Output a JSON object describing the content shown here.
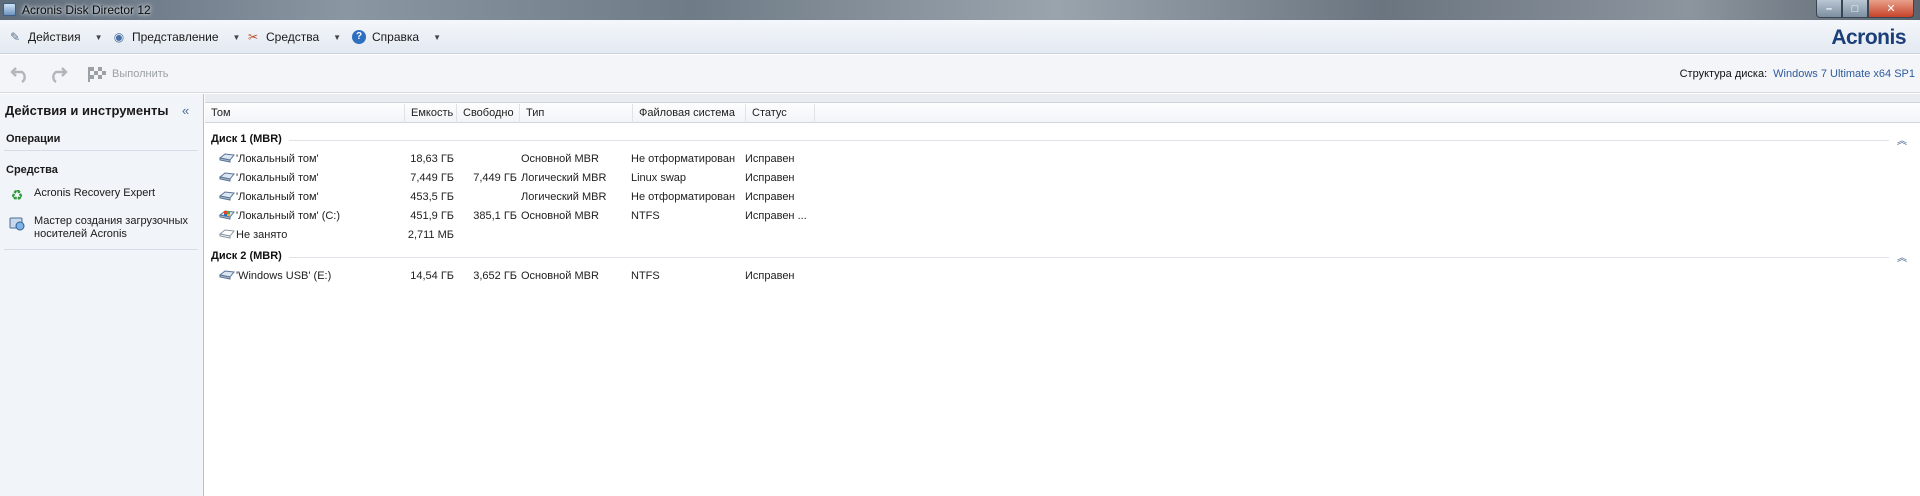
{
  "window": {
    "title": "Acronis Disk Director 12",
    "controls": {
      "minimize": "–",
      "maximize": "□",
      "close": "✕"
    }
  },
  "menu": {
    "items": [
      {
        "label": "Действия",
        "icon": "wrench-icon"
      },
      {
        "label": "Представление",
        "icon": "eye-icon"
      },
      {
        "label": "Средства",
        "icon": "tools-icon"
      },
      {
        "label": "Справка",
        "icon": "help-icon"
      }
    ],
    "logo": "Acronis"
  },
  "toolbar": {
    "undo_icon": "undo-icon",
    "redo_icon": "redo-icon",
    "run_label": "Выполнить",
    "disk_structure_label": "Структура диска:",
    "disk_structure_value": "Windows 7 Ultimate x64 SP1"
  },
  "sidebar": {
    "header": "Действия и инструменты",
    "collapse_glyph": "«",
    "sections": {
      "operations": "Операции",
      "tools": "Средства"
    },
    "tools": [
      {
        "label": "Acronis Recovery Expert",
        "icon": "recycle-icon"
      },
      {
        "label": "Мастер создания загрузочных носителей Acronis",
        "icon": "bootable-media-icon"
      }
    ]
  },
  "table": {
    "columns": [
      "Том",
      "Емкость",
      "Свободно",
      "Тип",
      "Файловая система",
      "Статус"
    ],
    "groups": [
      {
        "title": "Диск 1 (MBR)",
        "rows": [
          {
            "volume": "'Локальный том'",
            "capacity": "18,63 ГБ",
            "free": "",
            "type": "Основной MBR",
            "fs": "Не отформатирован",
            "status": "Исправен",
            "icon": "volume-icon"
          },
          {
            "volume": "'Локальный том'",
            "capacity": "7,449 ГБ",
            "free": "7,449 ГБ",
            "type": "Логический MBR",
            "fs": "Linux swap",
            "status": "Исправен",
            "icon": "volume-icon"
          },
          {
            "volume": "'Локальный том'",
            "capacity": "453,5 ГБ",
            "free": "",
            "type": "Логический MBR",
            "fs": "Не отформатирован",
            "status": "Исправен",
            "icon": "volume-icon"
          },
          {
            "volume": "'Локальный том' (C:)",
            "capacity": "451,9 ГБ",
            "free": "385,1 ГБ",
            "type": "Основной MBR",
            "fs": "NTFS",
            "status": "Исправен ...",
            "icon": "system-volume-icon"
          },
          {
            "volume": "Не занято",
            "capacity": "2,711 МБ",
            "free": "",
            "type": "",
            "fs": "",
            "status": "",
            "icon": "unallocated-icon"
          }
        ]
      },
      {
        "title": "Диск 2 (MBR)",
        "rows": [
          {
            "volume": "'Windows USB' (E:)",
            "capacity": "14,54 ГБ",
            "free": "3,652 ГБ",
            "type": "Основной MBR",
            "fs": "NTFS",
            "status": "Исправен",
            "icon": "volume-icon"
          }
        ]
      }
    ],
    "collapse_glyph": "︽"
  }
}
